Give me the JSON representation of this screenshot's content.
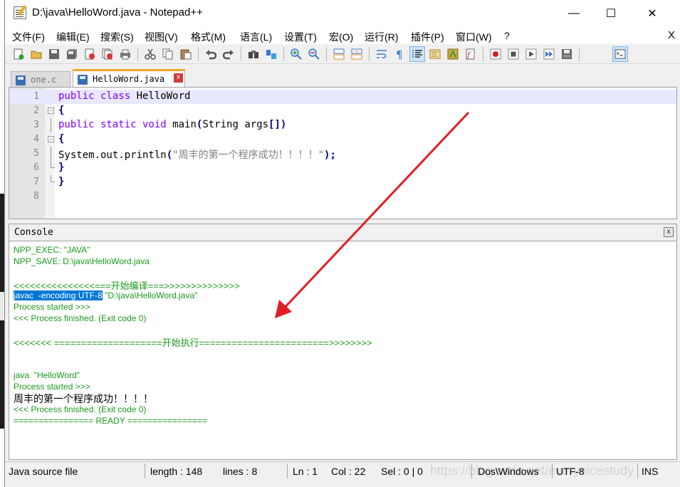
{
  "window": {
    "title": "D:\\java\\HelloWord.java - Notepad++",
    "minimize": "—",
    "maximize": "☐",
    "close": "✕"
  },
  "menu": {
    "items": [
      "文件(F)",
      "编辑(E)",
      "搜索(S)",
      "视图(V)",
      "格式(M)",
      "语言(L)",
      "设置(T)",
      "宏(O)",
      "运行(R)",
      "插件(P)",
      "窗口(W)",
      "?"
    ],
    "close": "X"
  },
  "toolbar": {
    "icons": [
      "new-file-icon",
      "open-file-icon",
      "save-icon",
      "save-all-icon",
      "close-icon",
      "close-all-icon",
      "print-icon",
      "cut-icon",
      "copy-icon",
      "paste-icon",
      "undo-icon",
      "redo-icon",
      "find-icon",
      "replace-icon",
      "zoom-in-icon",
      "zoom-out-icon",
      "sync-vertical-icon",
      "sync-horizontal-icon",
      "word-wrap-icon",
      "show-all-chars-icon",
      "indent-guide-icon",
      "document-map-icon",
      "function-list-icon",
      "folder-workspace-icon",
      "record-macro-icon",
      "stop-macro-icon",
      "play-macro-icon",
      "run-macro-multiple-icon",
      "save-macro-icon",
      "console-icon"
    ]
  },
  "tabs": [
    {
      "label": "one.c",
      "active": false
    },
    {
      "label": "HelloWord.java",
      "active": true,
      "close": "x"
    }
  ],
  "editor": {
    "lines": [
      {
        "num": "1",
        "parts": [
          [
            "kw",
            "public class "
          ],
          [
            "pl",
            "HelloWord"
          ]
        ]
      },
      {
        "num": "2",
        "parts": [
          [
            "op",
            "{"
          ]
        ]
      },
      {
        "num": "3",
        "parts": [
          [
            "kw",
            "public static void "
          ],
          [
            "pl",
            "main"
          ],
          [
            "op",
            "("
          ],
          [
            "pl",
            "String args"
          ],
          [
            "op",
            "[])"
          ]
        ]
      },
      {
        "num": "4",
        "parts": [
          [
            "op",
            "{"
          ]
        ]
      },
      {
        "num": "5",
        "parts": [
          [
            "pl",
            "System.out.println"
          ],
          [
            "op",
            "("
          ],
          [
            "str",
            "\"周丰的第一个程序成功！！！！\""
          ],
          [
            "op",
            ");"
          ]
        ]
      },
      {
        "num": "6",
        "parts": [
          [
            "op",
            "}"
          ]
        ]
      },
      {
        "num": "7",
        "parts": [
          [
            "op",
            "}"
          ]
        ]
      },
      {
        "num": "8",
        "parts": []
      }
    ]
  },
  "console": {
    "title": "Console",
    "close": "x",
    "lines": {
      "l1": "NPP_EXEC: \"JAVA\"",
      "l2": "NPP_SAVE: D:\\java\\HelloWord.java",
      "l3": "<<<<<<<<<<<<<<<===开始编译===>>>>>>>>>>>>>>",
      "l4_selected": "javac  -encoding UTF-8",
      "l4_rest": " \"D:\\java\\HelloWord.java\"",
      "l5": "Process started >>>",
      "l6": "<<< Process finished. (Exit code 0)",
      "l7": "<<<<<<< ====================开始执行========================>>>>>>>>",
      "l8": "java  \"HelloWord\"",
      "l9": "Process started >>>",
      "l10": "周丰的第一个程序成功！！！！",
      "l11": "<<< Process finished. (Exit code 0)",
      "l12": "================ READY ================"
    }
  },
  "status": {
    "file_type": "Java source file",
    "length": "length : 148",
    "lines": "lines : 8",
    "ln": "Ln : 1",
    "col": "Col : 22",
    "sel": "Sel : 0 | 0",
    "eol": "Dos\\Windows",
    "encoding": "UTF-8",
    "mode": "INS"
  },
  "watermark": "https://blog.csdn.net/everynicestudy",
  "colors": {
    "keyword": "#8000ff",
    "operator": "#000080",
    "string": "#808080",
    "console_text": "#1a9a1a",
    "arrow": "#e31e24",
    "active_tab_accent": "#f5a623"
  }
}
